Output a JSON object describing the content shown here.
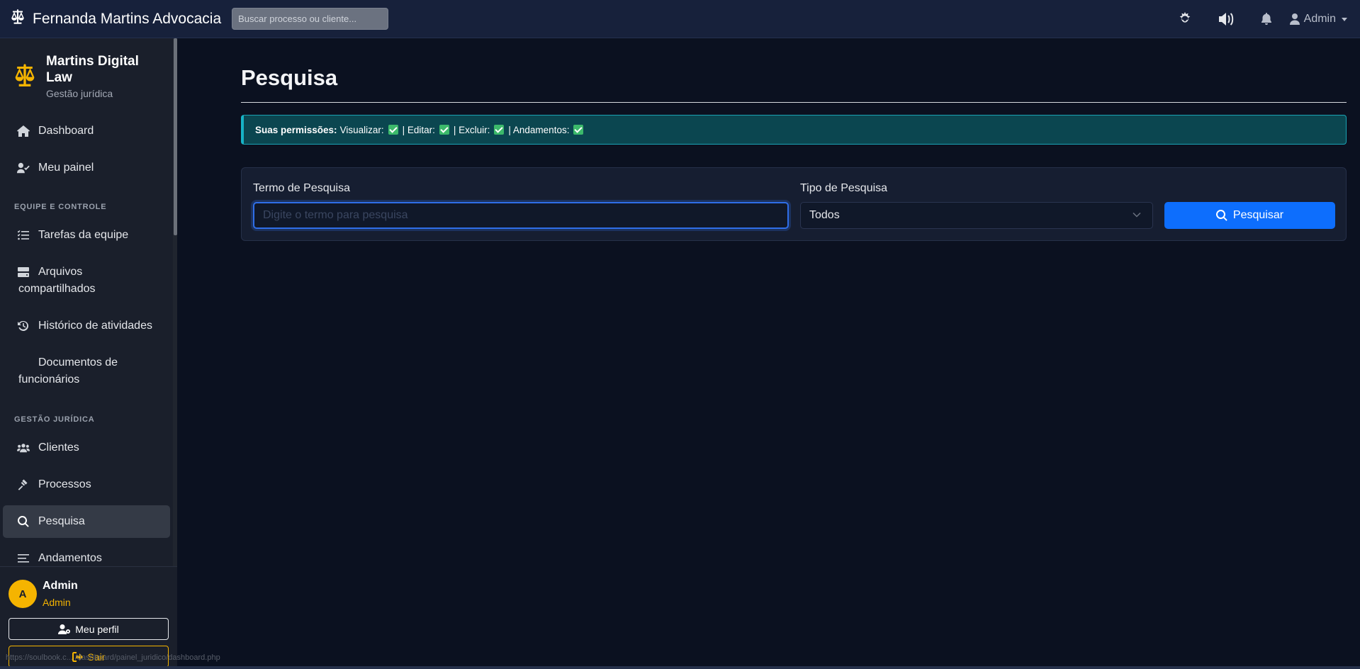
{
  "topbar": {
    "brand": "Fernanda Martins Advocacia",
    "search_placeholder": "Buscar processo ou cliente...",
    "user_label": "Admin"
  },
  "sidebar": {
    "brand_title": "Martins Digital Law",
    "brand_subtitle": "Gestão jurídica",
    "items": [
      {
        "label": "Dashboard",
        "icon": "home-icon"
      },
      {
        "label": "Meu painel",
        "icon": "user-check-icon"
      },
      {
        "label": "Tarefas da equipe",
        "icon": "tasks-icon"
      },
      {
        "label": "Arquivos compartilhados",
        "icon": "drive-icon"
      },
      {
        "label": "Histórico de atividades",
        "icon": "history-icon"
      },
      {
        "label": "Documentos de funcionários",
        "icon": ""
      },
      {
        "label": "Clientes",
        "icon": "users-icon"
      },
      {
        "label": "Processos",
        "icon": "gavel-icon"
      },
      {
        "label": "Pesquisa",
        "icon": "search-icon"
      },
      {
        "label": "Andamentos",
        "icon": "list-icon"
      }
    ],
    "sections": [
      "EQUIPE E CONTROLE",
      "GESTÃO JURÍDICA"
    ],
    "active_item": "Pesquisa",
    "user": {
      "initial": "A",
      "name": "Admin",
      "role": "Admin",
      "profile_label": "Meu perfil",
      "exit_label": "Sair"
    },
    "status_url": "https://soulbook.c... /dashboard/painel_juridico/dashboard.php"
  },
  "main": {
    "title": "Pesquisa",
    "permissions": {
      "label": "Suas permissões:",
      "view": "Visualizar:",
      "edit": "| Editar:",
      "delete": "| Excluir:",
      "progress": "| Andamentos:"
    },
    "search_form": {
      "term_label": "Termo de Pesquisa",
      "term_placeholder": "Digite o termo para pesquisa",
      "term_value": "",
      "type_label": "Tipo de Pesquisa",
      "type_value": "Todos",
      "button_label": "Pesquisar"
    }
  },
  "colors": {
    "accent": "#0d6efd",
    "brand_gold": "#f5b400",
    "alert_bg": "#0b4650",
    "check_green": "#3cb96b"
  }
}
